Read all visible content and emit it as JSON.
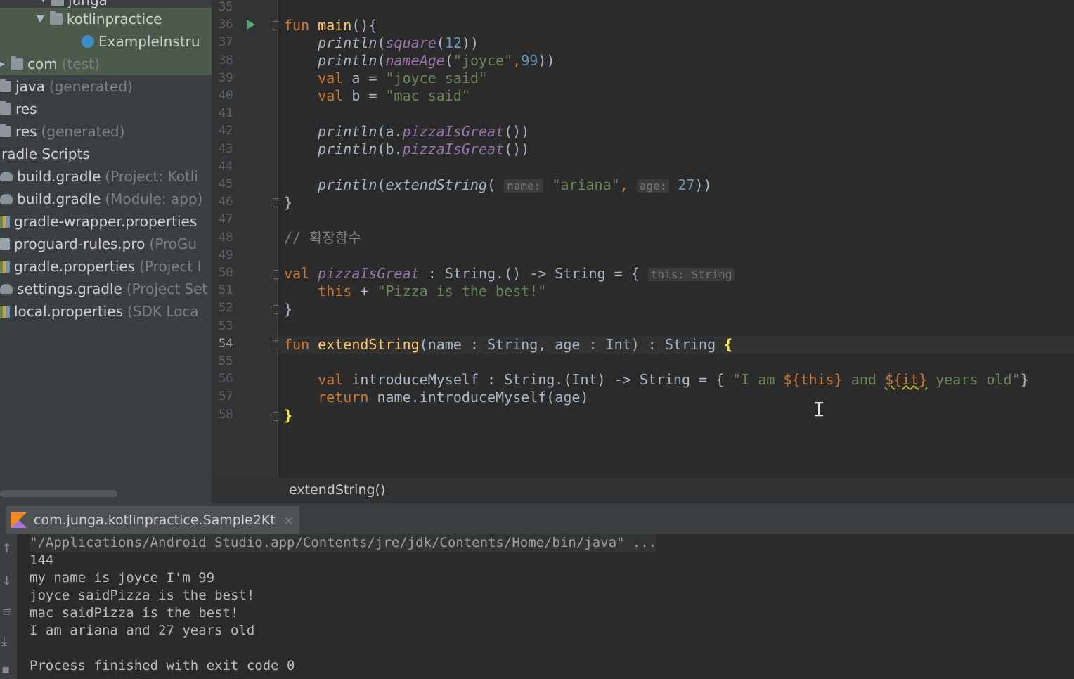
{
  "project_tree": {
    "items": [
      {
        "label": "junga",
        "hint": ""
      },
      {
        "label": "kotlinpractice",
        "hint": ""
      },
      {
        "label": "ExampleInstru",
        "hint": ""
      },
      {
        "label": "com",
        "hint": "(test)"
      },
      {
        "label": "java",
        "hint": "(generated)"
      },
      {
        "label": "res",
        "hint": ""
      },
      {
        "label": "res",
        "hint": "(generated)"
      },
      {
        "label": "radle Scripts",
        "hint": ""
      },
      {
        "label": "build.gradle",
        "hint": "(Project: Kotli"
      },
      {
        "label": "build.gradle",
        "hint": "(Module: app)"
      },
      {
        "label": "gradle-wrapper.properties",
        "hint": ""
      },
      {
        "label": "proguard-rules.pro",
        "hint": "(ProGu"
      },
      {
        "label": "gradle.properties",
        "hint": "(Project I"
      },
      {
        "label": "settings.gradle",
        "hint": "(Project Set"
      },
      {
        "label": "local.properties",
        "hint": "(SDK Loca"
      }
    ]
  },
  "line_numbers": [
    "35",
    "36",
    "37",
    "38",
    "39",
    "40",
    "41",
    "42",
    "43",
    "44",
    "45",
    "46",
    "47",
    "48",
    "49",
    "50",
    "51",
    "52",
    "53",
    "54",
    "55",
    "56",
    "57",
    "58"
  ],
  "code": {
    "l36": {
      "kw": "fun",
      "name": "main",
      "rest": "(){"
    },
    "l37": {
      "call": "println",
      "ext": "square",
      "open": "(",
      "num": "12",
      "close": "))"
    },
    "l38": {
      "call": "println",
      "ext": "nameAge",
      "open": "(",
      "str": "\"joyce\"",
      "comma": ",",
      "num": "99",
      "close": "))"
    },
    "l39": {
      "kw": "val",
      "rest": " a = ",
      "str": "\"joyce said\""
    },
    "l40": {
      "kw": "val",
      "rest": " b = ",
      "str": "\"mac said\""
    },
    "l42": {
      "call": "println",
      "pre": "(a.",
      "ext": "pizzaIsGreat",
      "post": "())"
    },
    "l43": {
      "call": "println",
      "pre": "(b.",
      "ext": "pizzaIsGreat",
      "post": "())"
    },
    "l45": {
      "call": "println",
      "pre": "(",
      "fn": "extendString",
      "open": "(",
      "hint1": "name:",
      "str": "\"ariana\"",
      "comma": ",",
      "hint2": "age:",
      "num": "27",
      "close": "))"
    },
    "l46": {
      "text": "}"
    },
    "l48": {
      "text": "// 확장함수"
    },
    "l50": {
      "kw": "val",
      "ext": "pizzaIsGreat",
      "rest": " : String.() -> String = {",
      "hint": "this: String"
    },
    "l51": {
      "kw": "this",
      "rest": " + ",
      "str": "\"Pizza is the best!\""
    },
    "l52": {
      "text": "}"
    },
    "l54": {
      "kw": "fun",
      "name": "extendString",
      "rest": "(name : String, age : Int) : String ",
      "brace": "{"
    },
    "l56": {
      "kw": "val",
      "rest": " introduceMyself : String.(Int) -> String = { ",
      "s1": "\"I am ",
      "t1": "${this}",
      "s2": " and ",
      "t2": "${it}",
      "s3": " years old\"",
      "end": "}"
    },
    "l57": {
      "kw": "return",
      "rest": " name.introduceMyself(age)"
    },
    "l58": {
      "brace": "}"
    }
  },
  "breadcrumb": "extendString()",
  "run_panel": {
    "tab_label": "com.junga.kotlinpractice.Sample2Kt",
    "close_glyph": "×",
    "console": [
      "\"/Applications/Android Studio.app/Contents/jre/jdk/Contents/Home/bin/java\" ...",
      "144",
      "my name is joyce I'm 99",
      "joyce saidPizza is the best!",
      "mac saidPizza is the best!",
      "I am ariana and 27 years old",
      "",
      "Process finished with exit code 0"
    ]
  },
  "icons": {
    "run_gutter": "run-icon",
    "folder": "folder-icon",
    "kotlin": "kotlin-icon"
  },
  "colors": {
    "keyword": "#cc7832",
    "function": "#ffc66d",
    "string": "#6a8759",
    "number": "#6897bb",
    "extension": "#9876aa",
    "run_green": "#59a869"
  }
}
